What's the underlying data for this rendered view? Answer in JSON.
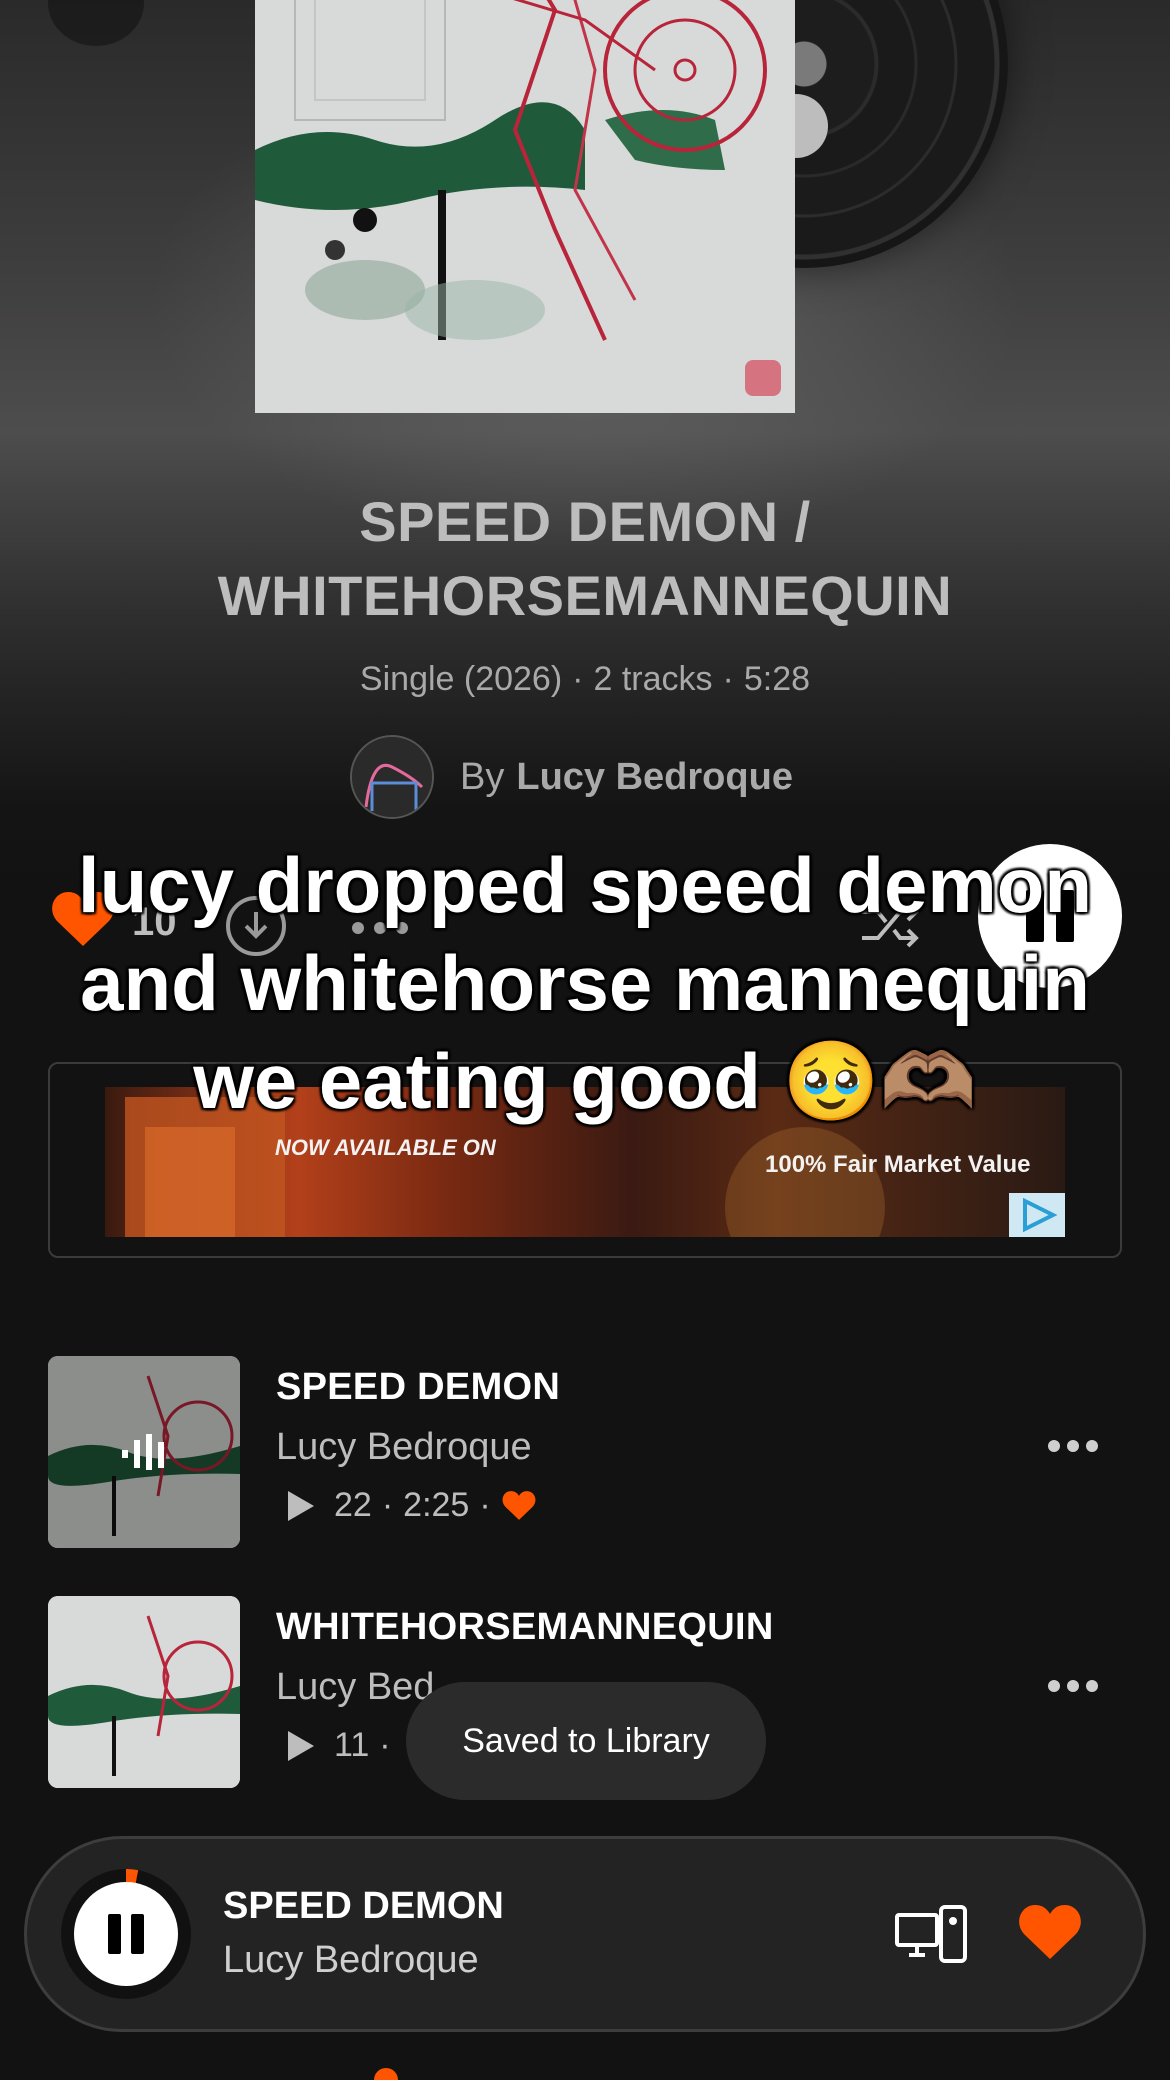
{
  "album": {
    "title_line1": "SPEED DEMON /",
    "title_line2": "WHITEHORSEMANNEQUIN",
    "type_year": "Single (2026)",
    "track_count": "2 tracks",
    "duration": "5:28",
    "by_label": "By",
    "artist": "Lucy Bedroque"
  },
  "actions": {
    "like_count": "10"
  },
  "caption": "lucy dropped speed demon and whitehorse mannequin we eating good 🥹🫶🏽",
  "ad": {
    "text_left": "NOW AVAILABLE ON",
    "text_right": "100% Fair Market Value"
  },
  "tracks": [
    {
      "title": "SPEED DEMON",
      "artist": "Lucy Bedroque",
      "plays": "22",
      "duration": "2:25",
      "liked": true
    },
    {
      "title": "WHITEHORSEMANNEQUIN",
      "artist": "Lucy Bed",
      "plays": "11"
    }
  ],
  "toast": "Saved to Library",
  "mini_player": {
    "title": "SPEED DEMON",
    "artist": "Lucy Bedroque",
    "progress": 0.03
  },
  "colors": {
    "accent": "#ff5500",
    "background": "#121212"
  },
  "icons": [
    "back-arrow-icon",
    "heart-icon",
    "download-icon",
    "more-icon",
    "shuffle-icon",
    "pause-icon",
    "ad-choices-icon",
    "now-playing-icon",
    "play-icon",
    "cast-device-icon"
  ]
}
